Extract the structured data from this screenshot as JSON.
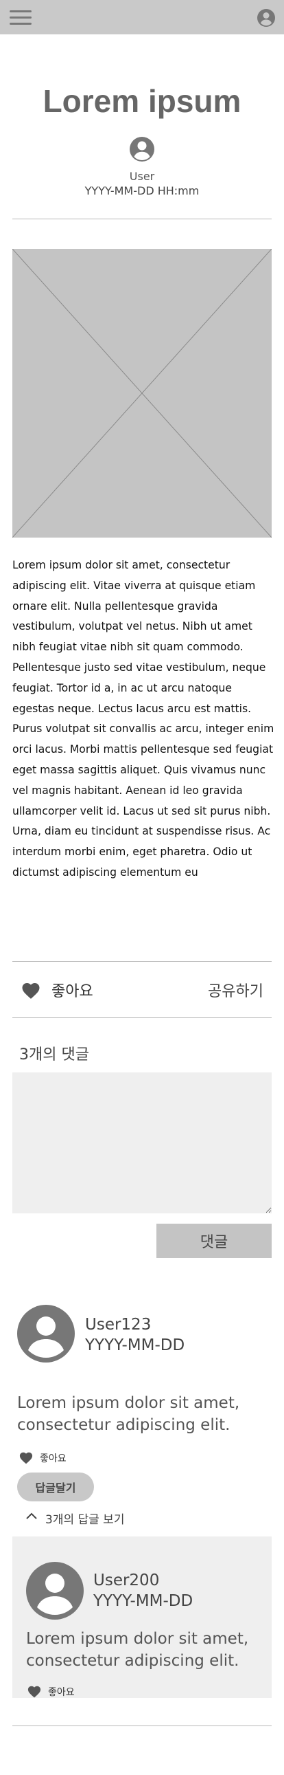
{
  "header": {
    "menu_icon": "hamburger-menu-icon",
    "profile_icon": "account-circle-icon"
  },
  "post": {
    "title": "Lorem ipsum",
    "author": "User",
    "date": "YYYY-MM-DD HH:mm",
    "image_icon": "image-placeholder",
    "body": "Lorem ipsum dolor sit amet, consectetur adipiscing elit. Vitae viverra at quisque etiam ornare elit. Nulla pellentesque gravida vestibulum, volutpat vel netus. Nibh ut amet nibh feugiat vitae nibh sit quam commodo. Pellentesque justo sed vitae vestibulum, neque feugiat. Tortor id a, in ac ut arcu natoque egestas neque. Lectus lacus arcu est mattis. Purus volutpat sit convallis ac arcu, integer enim orci lacus. Morbi mattis pellentesque sed feugiat eget massa sagittis aliquet. Quis vivamus nunc vel magnis habitant. Aenean id leo gravida ullamcorper velit id. Lacus ut sed sit purus nibh. Urna, diam eu tincidunt at suspendisse risus. Ac interdum morbi enim, eget pharetra. Odio ut dictumst adipiscing elementum eu"
  },
  "actions": {
    "like_label": "좋아요",
    "share_label": "공유하기"
  },
  "comments": {
    "count_label": "3개의 댓글",
    "submit_label": "댓글",
    "items": [
      {
        "user": "User123",
        "date": "YYYY-MM-DD",
        "text": "Lorem ipsum dolor sit amet, consectetur adipiscing elit.",
        "like_label": "좋아요",
        "reply_button": "답글달기",
        "view_replies": "3개의 답글 보기",
        "replies": [
          {
            "user": "User200",
            "date": "YYYY-MM-DD",
            "text": "Lorem ipsum dolor sit amet, consectetur adipiscing elit.",
            "like_label": "좋아요"
          }
        ]
      }
    ]
  },
  "colors": {
    "topbar": "#c9c9c9",
    "placeholder": "#c4c4c4",
    "panel": "#efefef",
    "icon": "#777777"
  }
}
